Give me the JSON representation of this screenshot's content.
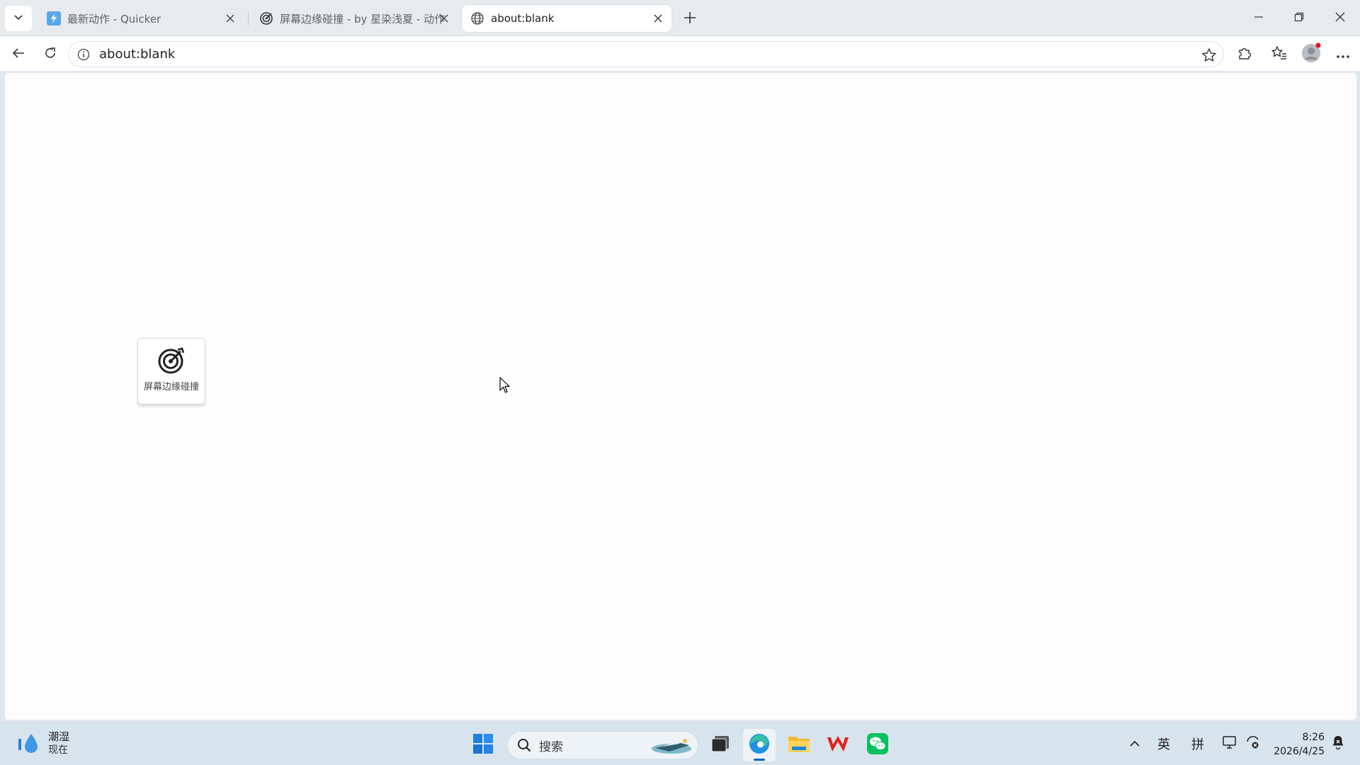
{
  "browser": {
    "tabs": [
      {
        "title": "最新动作 - Quicker",
        "icon": "quicker-icon",
        "active": false
      },
      {
        "title": "屏幕边缘碰撞 - by 星染浅夏 - 动作",
        "icon": "target-icon",
        "active": false
      },
      {
        "title": "about:blank",
        "icon": "globe-icon",
        "active": true
      }
    ],
    "address": {
      "url": "about:blank"
    }
  },
  "floating_widget": {
    "label": "屏幕边缘碰撞",
    "icon": "target-icon"
  },
  "taskbar": {
    "weather": {
      "condition": "潮湿",
      "time": "现在",
      "icon": "water-drop-icon"
    },
    "search": {
      "placeholder": "搜索"
    },
    "apps": [
      "windows-start-icon",
      "search-icon",
      "task-view-icon",
      "edge-icon",
      "file-explorer-icon",
      "wps-icon",
      "wechat-icon"
    ],
    "tray": {
      "ime_lang": "英",
      "ime_mode": "拼"
    },
    "clock": {
      "time": "8:26",
      "date": "2026/4/25"
    }
  },
  "colors": {
    "accent": "#0067c0",
    "wps_red": "#e2231a",
    "wechat_green": "#07c160",
    "profile_badge": "#e81123"
  }
}
